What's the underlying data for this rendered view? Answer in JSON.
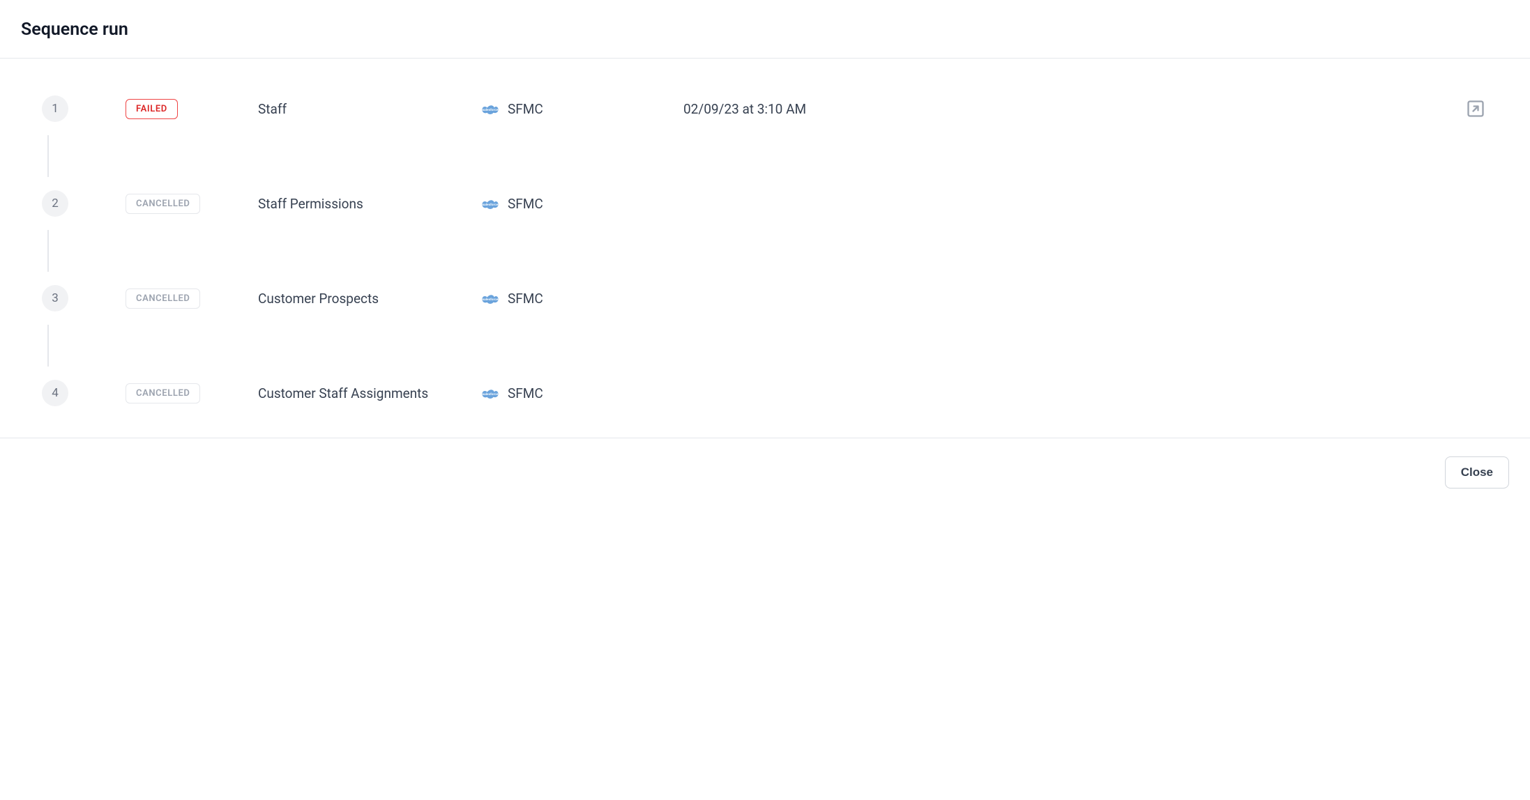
{
  "header": {
    "title": "Sequence run"
  },
  "status_labels": {
    "failed": "FAILED",
    "cancelled": "CANCELLED"
  },
  "steps": [
    {
      "num": "1",
      "status": "failed",
      "name": "Staff",
      "destination": "SFMC",
      "timestamp": "02/09/23 at 3:10 AM",
      "has_open": true
    },
    {
      "num": "2",
      "status": "cancelled",
      "name": "Staff Permissions",
      "destination": "SFMC",
      "timestamp": "",
      "has_open": false
    },
    {
      "num": "3",
      "status": "cancelled",
      "name": "Customer Prospects",
      "destination": "SFMC",
      "timestamp": "",
      "has_open": false
    },
    {
      "num": "4",
      "status": "cancelled",
      "name": "Customer Staff Assignments",
      "destination": "SFMC",
      "timestamp": "",
      "has_open": false
    }
  ],
  "footer": {
    "close_label": "Close"
  }
}
